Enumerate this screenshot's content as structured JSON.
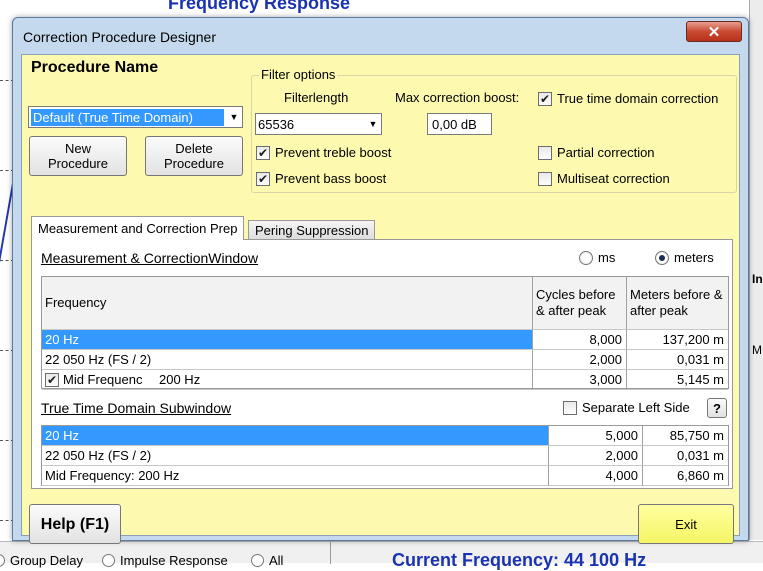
{
  "background": {
    "top_title": "Frequency Response",
    "bottom_radios": [
      "Group Delay",
      "Impulse Response",
      "All"
    ],
    "current_frequency": "Current Frequency: 44 100 Hz",
    "side_labels": [
      "In",
      "M"
    ]
  },
  "window": {
    "title": "Correction Procedure Designer",
    "close_glyph": "✕"
  },
  "procedure": {
    "heading": "Procedure Name",
    "selected": "Default (True Time Domain)",
    "new_button": "New\nProcedure",
    "delete_button": "Delete\nProcedure"
  },
  "filter_options": {
    "legend": "Filter options",
    "filterlength_label": "Filterlength",
    "filterlength_value": "65536",
    "max_boost_label": "Max correction boost:",
    "max_boost_value": "0,00 dB",
    "checks": {
      "true_time": {
        "label": "True time domain correction",
        "checked": true
      },
      "prevent_treble": {
        "label": "Prevent treble boost",
        "checked": true
      },
      "prevent_bass": {
        "label": "Prevent bass boost",
        "checked": true
      },
      "partial": {
        "label": "Partial correction",
        "checked": false
      },
      "multiseat": {
        "label": "Multiseat correction",
        "checked": false
      }
    }
  },
  "tabs": [
    {
      "label": "Measurement and Correction Prep",
      "active": true
    },
    {
      "label": "Pering Suppression",
      "active": false
    }
  ],
  "measurement": {
    "title": "Measurement & CorrectionWindow",
    "unit_ms": "ms",
    "unit_meters": "meters",
    "selected_unit": "meters",
    "headers": [
      "Frequency",
      "Cycles before & after peak",
      "Meters before & after peak"
    ],
    "rows": [
      {
        "freq": "20 Hz",
        "cycles": "8,000",
        "meters": "137,200 m"
      },
      {
        "freq": "22 050 Hz (FS / 2)",
        "cycles": "2,000",
        "meters": "0,031 m"
      },
      {
        "freq": "Mid Frequenc",
        "freq_value": "200 Hz",
        "checked": true,
        "cycles": "3,000",
        "meters": "5,145 m"
      }
    ]
  },
  "subwindow": {
    "title": "True Time Domain Subwindow",
    "separate_label": "Separate Left Side",
    "separate_checked": false,
    "help_glyph": "?",
    "rows": [
      {
        "freq": "20 Hz",
        "cycles": "5,000",
        "meters": "85,750 m"
      },
      {
        "freq": "22 050 Hz (FS / 2)",
        "cycles": "2,000",
        "meters": "0,031 m"
      },
      {
        "freq": "Mid Frequency: 200 Hz",
        "cycles": "4,000",
        "meters": "6,860 m"
      }
    ]
  },
  "footer": {
    "help_label": "Help (F1)",
    "exit_label": "Exit"
  }
}
